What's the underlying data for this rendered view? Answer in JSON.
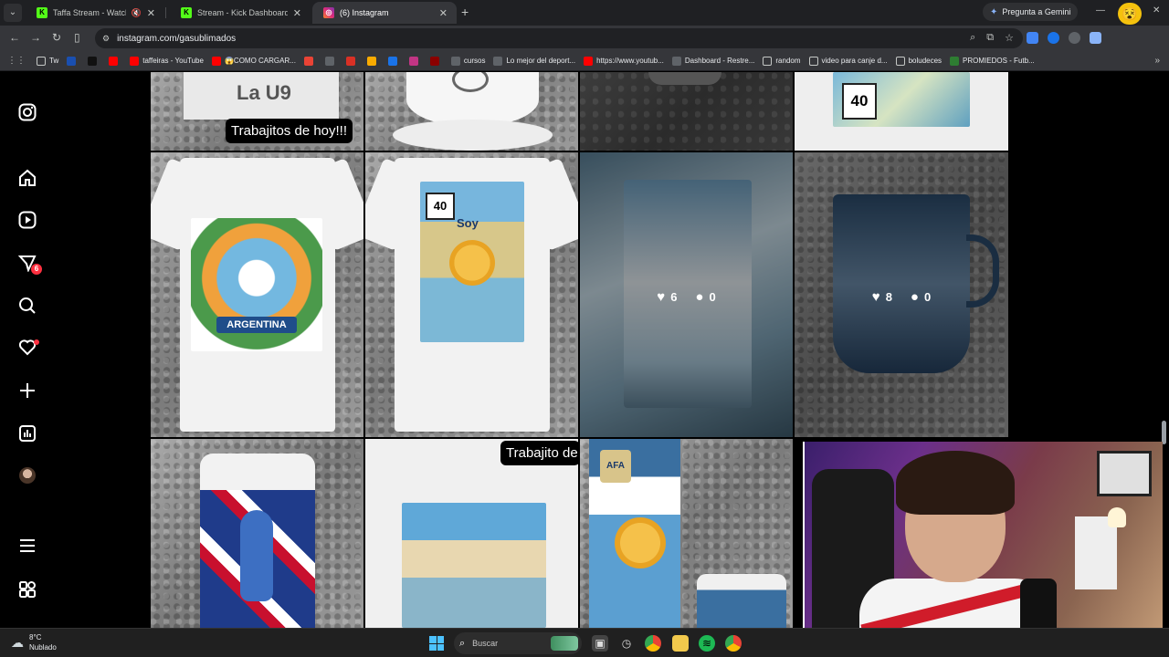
{
  "browser": {
    "tabs": [
      {
        "label": "Taffa Stream - Watch Live o",
        "favicon": "kick",
        "muted": true,
        "active": false
      },
      {
        "label": "Stream - Kick Dashboard",
        "favicon": "kick",
        "muted": false,
        "active": false
      },
      {
        "label": "(6) Instagram",
        "favicon": "instagram",
        "muted": false,
        "active": true
      }
    ],
    "gemini_label": "Pregunta a Gemini",
    "url": "instagram.com/gasublimados",
    "bookmarks": [
      {
        "label": "Tw",
        "icon": "folder-icon"
      },
      {
        "label": "",
        "icon": "pepsi-icon"
      },
      {
        "label": "",
        "icon": "tiktok-icon"
      },
      {
        "label": "",
        "icon": "youtube-icon"
      },
      {
        "label": "taffeiras - YouTube",
        "icon": "youtube-icon"
      },
      {
        "label": "😱COMO CARGAR...",
        "icon": "youtube-icon"
      },
      {
        "label": "",
        "icon": "gmail-icon"
      },
      {
        "label": "",
        "icon": "globe-icon"
      },
      {
        "label": "",
        "icon": "red-icon"
      },
      {
        "label": "",
        "icon": "yellow-icon"
      },
      {
        "label": "",
        "icon": "blue-icon"
      },
      {
        "label": "",
        "icon": "instagram-icon"
      },
      {
        "label": "",
        "icon": "shield-icon"
      },
      {
        "label": "cursos",
        "icon": "globe-icon"
      },
      {
        "label": "Lo mejor del deport...",
        "icon": "globe-icon"
      },
      {
        "label": "https://www.youtub...",
        "icon": "youtube-icon"
      },
      {
        "label": "Dashboard - Restre...",
        "icon": "globe-icon"
      },
      {
        "label": "random",
        "icon": "folder-icon"
      },
      {
        "label": "video para canje d...",
        "icon": "folder-icon"
      },
      {
        "label": "boludeces",
        "icon": "folder-icon"
      },
      {
        "label": "PROMIEDOS - Futb...",
        "icon": "promiedos-icon"
      }
    ]
  },
  "instagram": {
    "notification_count": "6",
    "posts": [
      {
        "overlay": "Trabajitos de hoy!!!",
        "print_text": "La U9"
      },
      {
        "overlay": ""
      },
      {
        "overlay": ""
      },
      {
        "overlay": "",
        "print_text": "40"
      },
      {
        "overlay": "",
        "print_text": "ARGENTINA"
      },
      {
        "overlay": "",
        "print_text": "40",
        "print_text2": "Soy"
      },
      {
        "overlay": "",
        "likes": "6",
        "comments": "0"
      },
      {
        "overlay": "",
        "likes": "8",
        "comments": "0"
      },
      {
        "overlay": ""
      },
      {
        "overlay": "Trabajito de"
      },
      {
        "overlay": ""
      }
    ]
  },
  "taskbar": {
    "temperature": "8°C",
    "weather": "Nublado",
    "search_placeholder": "Buscar"
  },
  "colors": {
    "chrome_dark": "#1f2023",
    "chrome_toolbar": "#35363a",
    "kick_green": "#53fc18",
    "ig_badge": "#ff3040",
    "win_accent": "#4cc2ff"
  }
}
